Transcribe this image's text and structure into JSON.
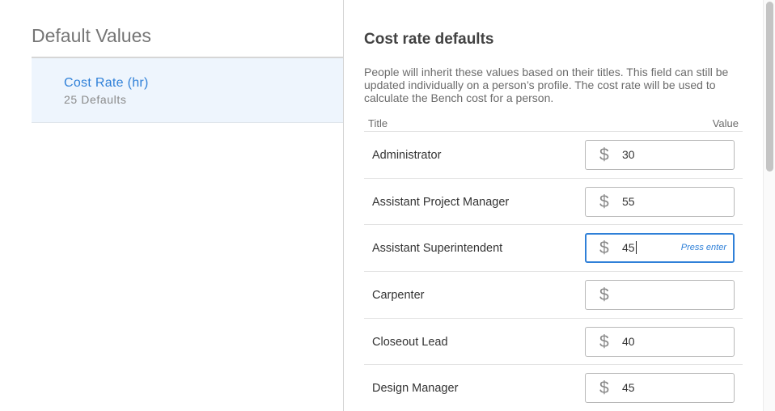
{
  "left": {
    "title": "Default Values",
    "item": {
      "label": "Cost Rate (hr)",
      "subtitle": "25 Defaults"
    }
  },
  "right": {
    "title": "Cost rate defaults",
    "description": "People will inherit these values based on their titles. This field can still be updated individually on a person’s profile. The cost rate will be used to calculate the Bench cost for a person.",
    "table": {
      "headers": {
        "title": "Title",
        "value": "Value"
      },
      "currency_symbol": "$",
      "rows": [
        {
          "title": "Administrator",
          "value": "30"
        },
        {
          "title": "Assistant Project Manager",
          "value": "55"
        },
        {
          "title": "Assistant Superintendent",
          "value": "45",
          "hint": "Press enter"
        },
        {
          "title": "Carpenter",
          "value": ""
        },
        {
          "title": "Closeout Lead",
          "value": "40"
        },
        {
          "title": "Design Manager",
          "value": "45"
        }
      ]
    }
  },
  "colors": {
    "accent": "#2f80d8",
    "selected_bg": "#eef5fd"
  }
}
